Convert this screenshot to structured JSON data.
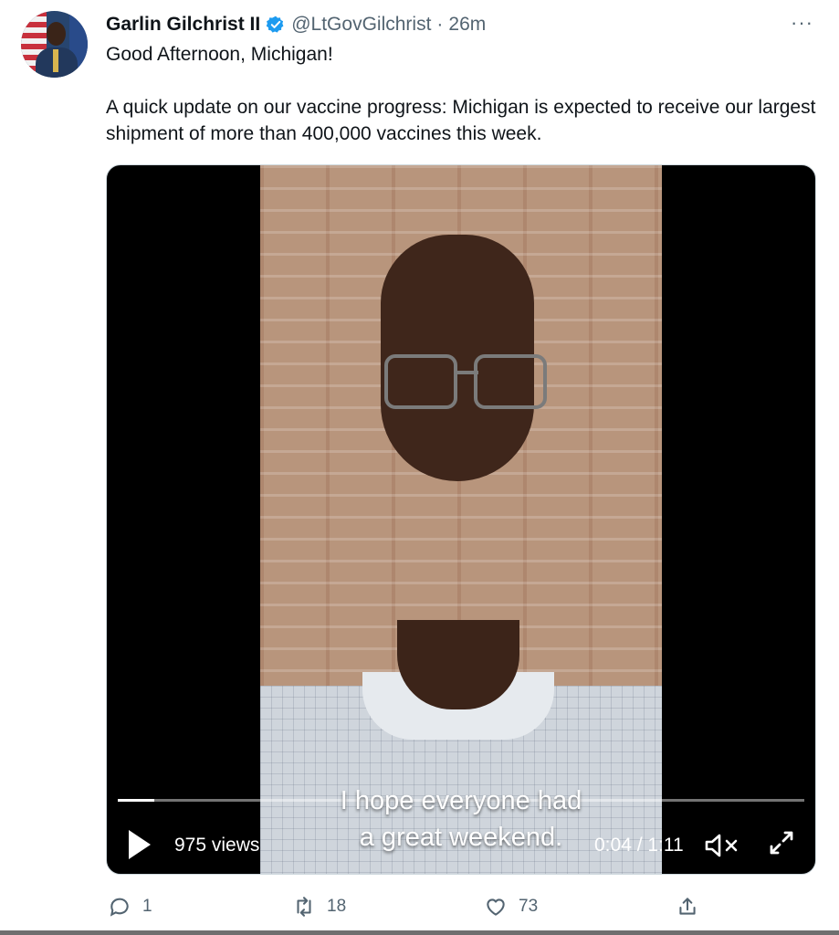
{
  "tweet": {
    "author_name": "Garlin Gilchrist II",
    "handle": "@LtGovGilchrist",
    "separator": "·",
    "time": "26m",
    "more": "···",
    "text_line1": "Good Afternoon, Michigan!",
    "text_line2": "A quick update on our vaccine progress: Michigan is expected to receive our largest shipment of more than 400,000 vaccines this week."
  },
  "video": {
    "caption_line1": "I hope everyone had",
    "caption_line2": "a great weekend.",
    "views": "975 views",
    "timecode": "0:04 / 1:11",
    "progress": 0.053
  },
  "actions": {
    "replies": "1",
    "retweets": "18",
    "likes": "73"
  },
  "icons": {
    "verified": "verified-badge-icon",
    "reply": "reply-icon",
    "retweet": "retweet-icon",
    "like": "heart-icon",
    "share": "share-icon",
    "play": "play-icon",
    "mute": "muted-speaker-icon",
    "fullscreen": "fullscreen-icon"
  },
  "colors": {
    "text": "#0f1419",
    "secondary": "#536471",
    "verified": "#1d9bf0"
  }
}
